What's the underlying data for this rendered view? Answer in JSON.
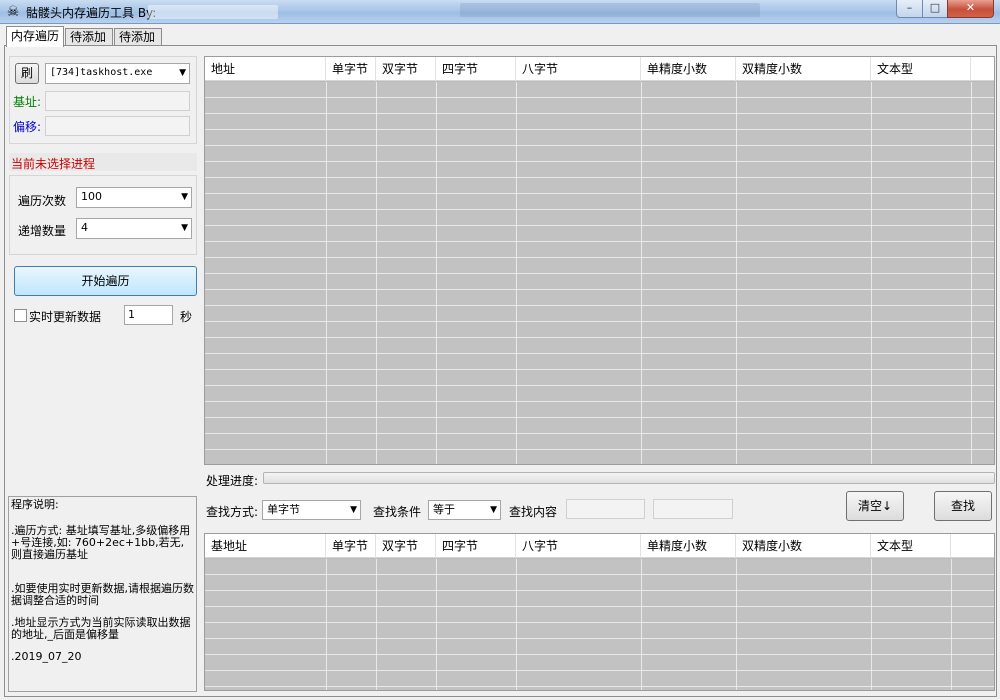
{
  "window": {
    "title": "骷髅头内存遍历工具 By:",
    "min": "–",
    "max": "□",
    "close": "✕"
  },
  "tabs": [
    "内存遍历",
    "待添加",
    "待添加"
  ],
  "left": {
    "refresh_label": "刷",
    "process_value": "[734]taskhost.exe",
    "base_label": "基址:",
    "offset_label": "偏移:",
    "status_text": "当前未选择进程",
    "count_label": "遍历次数",
    "count_value": "100",
    "step_label": "递增数量",
    "step_value": "4",
    "start_label": "开始遍历",
    "realtime_label": "实时更新数据",
    "interval_value": "1",
    "unit_label": "秒"
  },
  "colors": {
    "base_label": "#008000",
    "offset_label": "#0000cc",
    "status_text": "#cc0000"
  },
  "description": {
    "title": "程序说明:",
    "p1": ".遍历方式: 基址填写基址,多级偏移用+号连接,如: 760+2ec+1bb,若无,则直接遍历基址",
    "p2": ".如要使用实时更新数据,请根据遍历数据调整合适的时间",
    "p3": ".地址显示方式为当前实际读取出数据的地址,_后面是偏移量",
    "p4": ".2019_07_20"
  },
  "grid_top": {
    "columns": [
      "地址",
      "单字节",
      "双字节",
      "四字节",
      "八字节",
      "单精度小数",
      "双精度小数",
      "文本型"
    ]
  },
  "progress_label": "处理进度:",
  "search": {
    "mode_label": "查找方式:",
    "mode_value": "单字节",
    "cond_label": "查找条件",
    "cond_value": "等于",
    "content_label": "查找内容",
    "clear_label": "清空↓",
    "find_label": "查找"
  },
  "grid_bottom": {
    "columns": [
      "基地址",
      "单字节",
      "双字节",
      "四字节",
      "八字节",
      "单精度小数",
      "双精度小数",
      "文本型"
    ]
  }
}
